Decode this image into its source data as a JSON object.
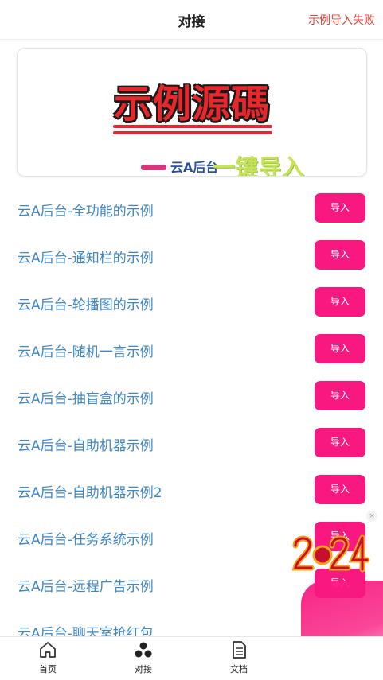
{
  "header": {
    "title": "对接",
    "action_label": "示例导入失败"
  },
  "banner": {
    "title": "示例源碼",
    "subtitle_small": "云A后台",
    "subtitle_big": "一键导入"
  },
  "items": [
    {
      "label": "云A后台-全功能的示例",
      "button": "导入"
    },
    {
      "label": "云A后台-通知栏的示例",
      "button": "导入"
    },
    {
      "label": "云A后台-轮播图的示例",
      "button": "导入"
    },
    {
      "label": "云A后台-随机一言示例",
      "button": "导入"
    },
    {
      "label": "云A后台-抽盲盒的示例",
      "button": "导入"
    },
    {
      "label": "云A后台-自助机器示例",
      "button": "导入"
    },
    {
      "label": "云A后台-自助机器示例2",
      "button": "导入"
    },
    {
      "label": "云A后台-任务系统示例",
      "button": "导入"
    },
    {
      "label": "云A后台-远程广告示例",
      "button": "导入"
    },
    {
      "label": "云A后台-聊天室抢红包",
      "button": ""
    }
  ],
  "floating_badge": {
    "close_label": "×"
  },
  "tabbar": {
    "tabs": [
      {
        "label": "首页",
        "icon": "home-icon"
      },
      {
        "label": "对接",
        "icon": "cluster-icon"
      },
      {
        "label": "文档",
        "icon": "document-icon"
      }
    ]
  },
  "colors": {
    "accent": "#f8187f",
    "link": "#3d86c7",
    "header_action": "#e0453a"
  }
}
